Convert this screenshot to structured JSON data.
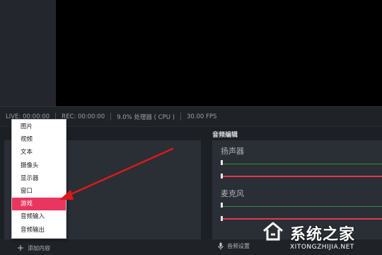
{
  "status_bar": {
    "live": "LIVE: 00:00:00",
    "rec": "REC: 00:00:00",
    "cpu": "9.0% 处理器 ( CPU )",
    "fps": "30.00 FPS"
  },
  "audio": {
    "title": "音频编辑",
    "channels": [
      {
        "label": "扬声器"
      },
      {
        "label": "麦克风"
      }
    ]
  },
  "bottom": {
    "add_content": "添加内容",
    "audio_settings": "音频设置"
  },
  "menu": {
    "items": [
      "图片",
      "视频",
      "文本",
      "摄像头",
      "显示器",
      "窗口",
      "游戏",
      "音频输入",
      "音频输出"
    ],
    "selected": "游戏",
    "selected_color": "#e8365e"
  },
  "watermark": {
    "text": "系统之家",
    "url": "XITONGZHIJIA.NET"
  },
  "colors": {
    "arrow": "#d91a1a",
    "slider_red": "#e0384f",
    "slider_green": "#2e8b3a"
  }
}
